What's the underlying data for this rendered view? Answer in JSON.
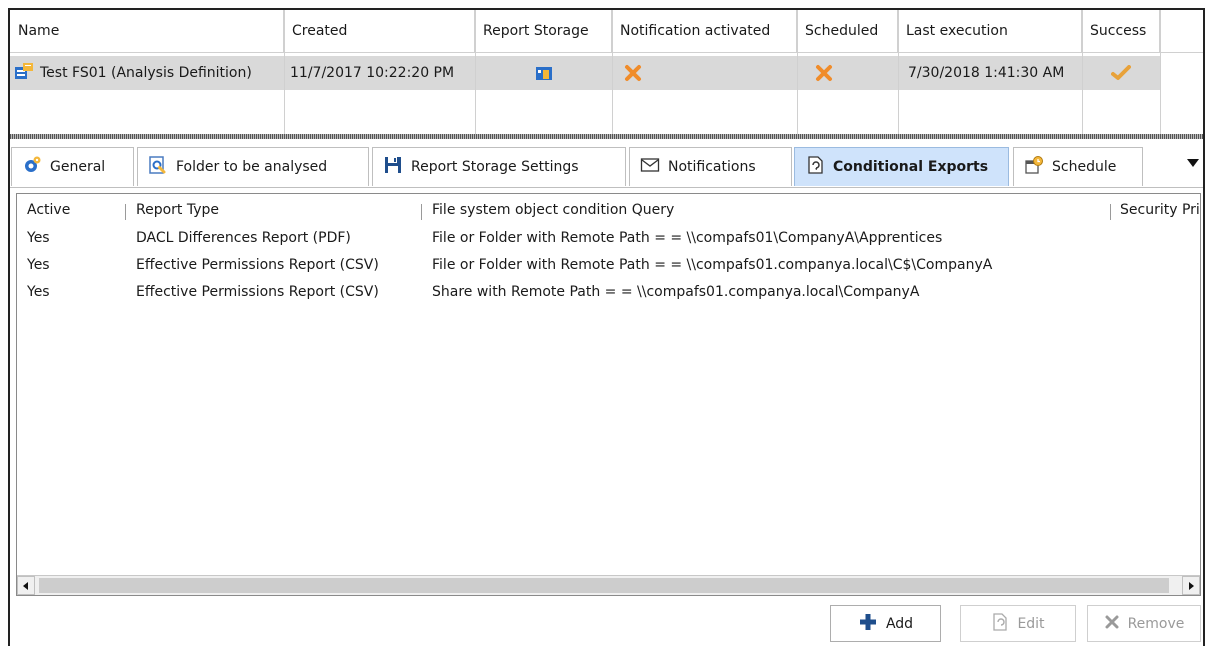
{
  "grid": {
    "columns": [
      "Name",
      "Created",
      "Report Storage",
      "Notification activated",
      "Scheduled",
      "Last execution",
      "Success"
    ],
    "row": {
      "name": "Test FS01 (Analysis Definition)",
      "created": "11/7/2017 10:22:20 PM",
      "last_execution": "7/30/2018 1:41:30 AM",
      "report_storage_icon": "report-storage-icon",
      "notification_icon": "x-icon",
      "scheduled_icon": "x-icon",
      "success_icon": "check-icon"
    }
  },
  "tabs": [
    {
      "label": "General",
      "icon": "gear-icon"
    },
    {
      "label": "Folder to be analysed",
      "icon": "folder-search-icon"
    },
    {
      "label": "Report Storage Settings",
      "icon": "floppy-icon"
    },
    {
      "label": "Notifications",
      "icon": "envelope-icon"
    },
    {
      "label": "Conditional Exports",
      "icon": "export-icon",
      "active": true
    },
    {
      "label": "Schedule",
      "icon": "schedule-icon"
    }
  ],
  "exports": {
    "columns": [
      "Active",
      "Report Type",
      "File system object condition Query",
      "Security Pri"
    ],
    "rows": [
      {
        "active": "Yes",
        "type": "DACL Differences Report (PDF)",
        "query": "File or Folder with Remote Path = = \\\\compafs01\\CompanyA\\Apprentices"
      },
      {
        "active": "Yes",
        "type": "Effective Permissions Report (CSV)",
        "query": "File or Folder with Remote Path = = \\\\compafs01.companya.local\\C$\\CompanyA"
      },
      {
        "active": "Yes",
        "type": "Effective Permissions Report (CSV)",
        "query": "Share with Remote Path = = \\\\compafs01.companya.local\\CompanyA"
      }
    ]
  },
  "buttons": {
    "add": "Add",
    "edit": "Edit",
    "remove": "Remove"
  },
  "colors": {
    "accent_add": "#1f4e8c",
    "x_orange": "#f08c2a",
    "check_orange": "#e8a23a",
    "active_tab": "#cfe3fb",
    "selected_row": "#d9d9d9"
  }
}
